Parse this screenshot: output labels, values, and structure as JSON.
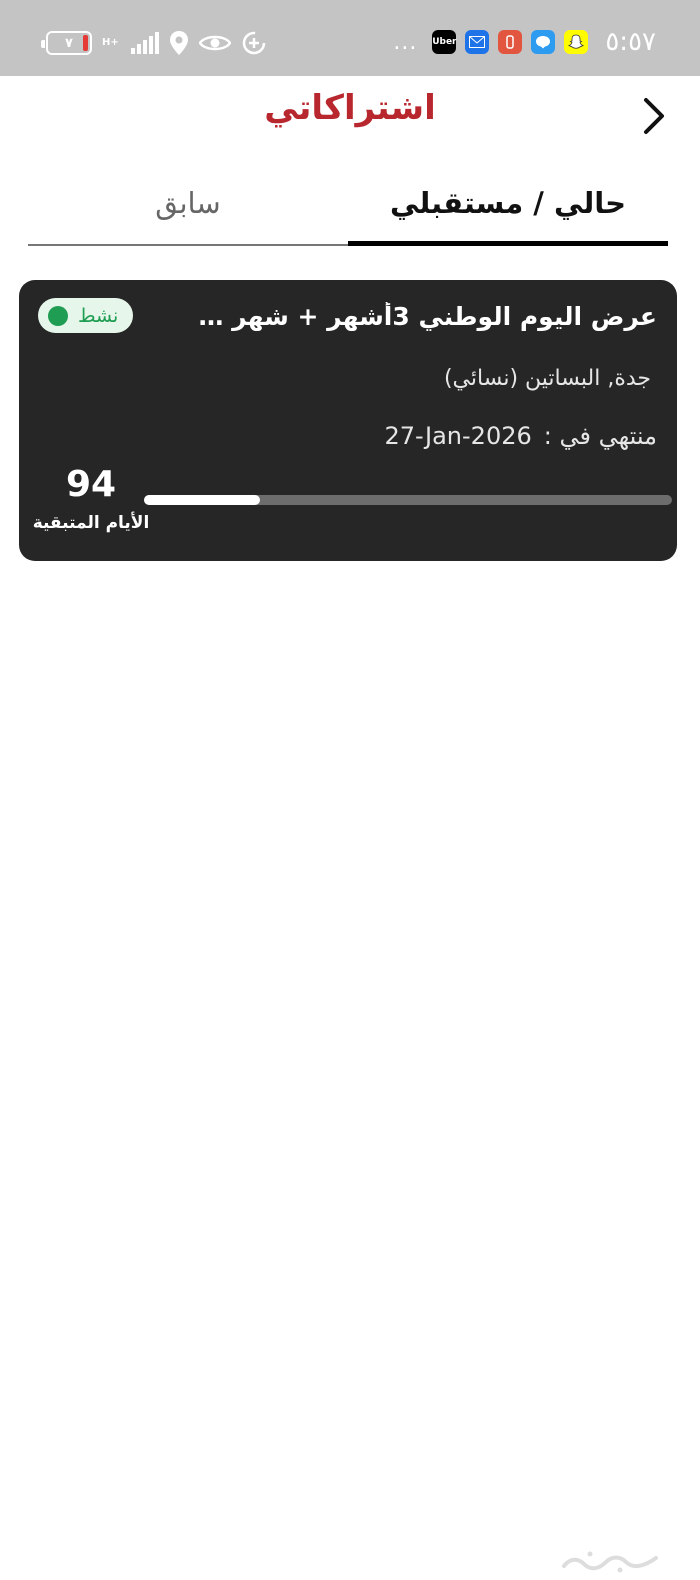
{
  "status_bar": {
    "time": "٥:٥٧",
    "battery_level": "٧",
    "network_type": "H+",
    "more_indicator": "...",
    "apps": [
      "uber",
      "mail",
      "notification-red",
      "messages",
      "snapchat"
    ],
    "uber_label": "Uber"
  },
  "header": {
    "title": "اشتراكاتي",
    "back_icon": "chevron-right-icon"
  },
  "tabs": [
    {
      "label": "حالي / مستقبلي",
      "active": true
    },
    {
      "label": "سابق",
      "active": false
    }
  ],
  "subscription": {
    "title": "عرض اليوم الوطني 3أشهر + شهر م...",
    "status": "نشط",
    "location": "جدة, البساتين (نسائي)",
    "expiry_label": "منتهي في :",
    "expiry_date": "27-Jan-2026",
    "days_remaining": "94",
    "days_label": "الأيام المتبقية",
    "progress_fraction": 0.22
  },
  "colors": {
    "title_red": "#b8262e",
    "card_bg": "#262626",
    "status_green": "#1f9d52",
    "status_bar_bg": "#c4c4c4"
  }
}
